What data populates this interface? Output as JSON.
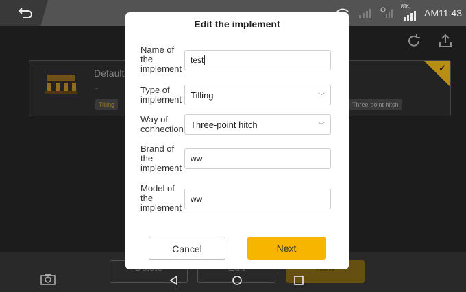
{
  "status_bar": {
    "time": "AM11:43",
    "rtk_label": "RTK",
    "icons": [
      "back-icon",
      "wifi-icon",
      "signal-icon",
      "satellite-icon",
      "rtk-signal-icon"
    ]
  },
  "implement_card": {
    "title": "Default",
    "subtitle": "-",
    "type_tag": "Tilling",
    "connection_tag": "Three-point hitch",
    "selected": true
  },
  "bottom_bar": {
    "delete_label": "Delete",
    "edit_label": "Edit",
    "new_label": "New"
  },
  "modal": {
    "title": "Edit the implement",
    "fields": [
      {
        "label": "Name of the implement",
        "value": "test",
        "kind": "text"
      },
      {
        "label": "Type of implement",
        "value": "Tilling",
        "kind": "select"
      },
      {
        "label": "Way of connection",
        "value": "Three-point hitch",
        "kind": "select"
      },
      {
        "label": "Brand of the implement",
        "value": "ww",
        "kind": "text"
      },
      {
        "label": "Model of the implement",
        "value": "ww",
        "kind": "text"
      }
    ],
    "cancel_label": "Cancel",
    "next_label": "Next"
  },
  "colors": {
    "accent": "#f7b500",
    "card_tag": "#b58a1c",
    "dark_bg": "#1f1f1f"
  }
}
